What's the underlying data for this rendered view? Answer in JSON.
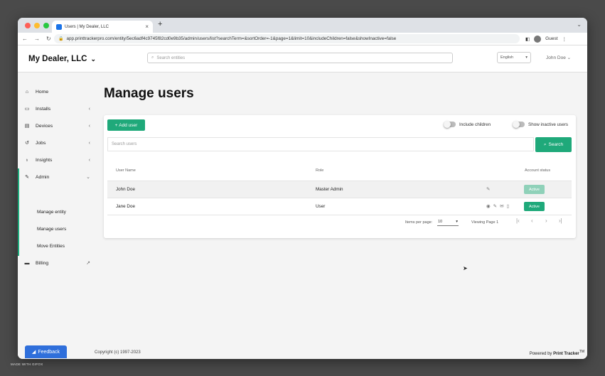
{
  "browser": {
    "tab_title": "Users | My Dealer, LLC",
    "new_tab": "+",
    "url": "app.printtrackerpro.com/entity/5ec6adf4c9745f82cd0e9b35/admin/users/list?searchTerm=&sortOrder=-1&page=1&limit=10&includeChildren=false&showInactive=false",
    "profile": "Guest",
    "dot_colors": [
      "#fe5f57",
      "#febc2e",
      "#28c840"
    ]
  },
  "header": {
    "brand": "My Dealer, LLC",
    "search_placeholder": "Search entities",
    "language": "English",
    "user": "John Doe"
  },
  "sidebar": {
    "items": [
      {
        "label": "Home",
        "icon": "home-icon"
      },
      {
        "label": "Installs",
        "icon": "monitor-icon"
      },
      {
        "label": "Devices",
        "icon": "printer-icon"
      },
      {
        "label": "Jobs",
        "icon": "history-icon"
      },
      {
        "label": "Insights",
        "icon": "lightbulb-icon"
      },
      {
        "label": "Admin",
        "icon": "wrench-icon"
      },
      {
        "label": "Billing",
        "icon": "credit-card-icon"
      }
    ],
    "admin_sub": [
      "Manage entity",
      "Manage users",
      "Move Entities"
    ],
    "accent": "#1faa7c"
  },
  "page": {
    "title": "Manage users",
    "add_user": "Add user",
    "include_children": "Include children",
    "show_inactive": "Show inactive users",
    "search_placeholder": "Search users",
    "search_btn": "Search",
    "columns": [
      "User Name",
      "Role",
      "Account status"
    ],
    "rows": [
      {
        "name": "John Doe",
        "role": "Master Admin",
        "status": "Active",
        "status_color": "#8fd1b9"
      },
      {
        "name": "Jane Doe",
        "role": "User",
        "status": "Active",
        "status_color": "#1fa97a"
      }
    ],
    "items_per_page_label": "Items per page:",
    "items_per_page": "10",
    "viewing": "Viewing Page 1"
  },
  "footer": {
    "copyright": "Copyright (c) 1997-2023",
    "powered_prefix": "Powered by ",
    "powered_brand": "Print Tracker",
    "tm": "TM",
    "feedback": "Feedback",
    "made_with": "MADE WITH GIFOX"
  }
}
